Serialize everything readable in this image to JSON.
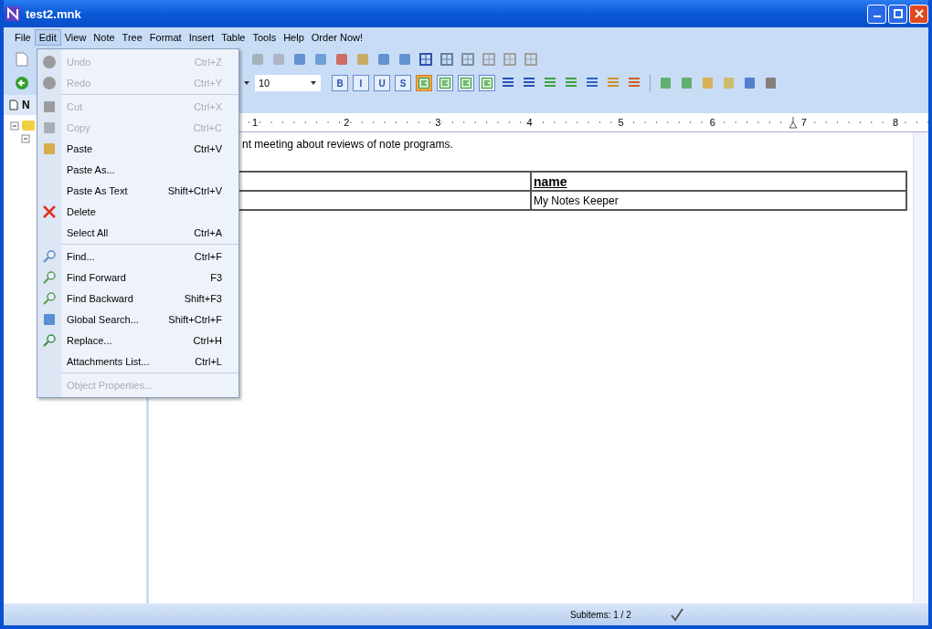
{
  "window": {
    "title": "test2.mnk"
  },
  "menubar": [
    {
      "label": "File",
      "selected": false
    },
    {
      "label": "Edit",
      "selected": true
    },
    {
      "label": "View",
      "selected": false
    },
    {
      "label": "Note",
      "selected": false
    },
    {
      "label": "Tree",
      "selected": false
    },
    {
      "label": "Format",
      "selected": false
    },
    {
      "label": "Insert",
      "selected": false
    },
    {
      "label": "Table",
      "selected": false
    },
    {
      "label": "Tools",
      "selected": false
    },
    {
      "label": "Help",
      "selected": false
    },
    {
      "label": "Order Now!",
      "selected": false
    }
  ],
  "edit_menu": [
    {
      "kind": "item",
      "label": "Undo",
      "shortcut": "Ctrl+Z",
      "disabled": true
    },
    {
      "kind": "item",
      "label": "Redo",
      "shortcut": "Ctrl+Y",
      "disabled": true
    },
    {
      "kind": "separator"
    },
    {
      "kind": "item",
      "label": "Cut",
      "shortcut": "Ctrl+X",
      "disabled": true
    },
    {
      "kind": "item",
      "label": "Copy",
      "shortcut": "Ctrl+C",
      "disabled": true
    },
    {
      "kind": "item",
      "label": "Paste",
      "shortcut": "Ctrl+V",
      "disabled": false
    },
    {
      "kind": "item",
      "label": "Paste As...",
      "disabled": false
    },
    {
      "kind": "item",
      "label": "Paste As Text",
      "shortcut": "Shift+Ctrl+V",
      "disabled": false
    },
    {
      "kind": "item",
      "label": "Delete",
      "disabled": false
    },
    {
      "kind": "item",
      "label": "Select All",
      "shortcut": "Ctrl+A",
      "disabled": false
    },
    {
      "kind": "separator"
    },
    {
      "kind": "item",
      "label": "Find...",
      "shortcut": "Ctrl+F",
      "disabled": false
    },
    {
      "kind": "item",
      "label": "Find Forward",
      "shortcut": "F3",
      "disabled": false
    },
    {
      "kind": "item",
      "label": "Find Backward",
      "shortcut": "Shift+F3",
      "disabled": false
    },
    {
      "kind": "item",
      "label": "Global Search...",
      "shortcut": "Shift+Ctrl+F",
      "disabled": false
    },
    {
      "kind": "item",
      "label": "Replace...",
      "shortcut": "Ctrl+H",
      "disabled": false
    },
    {
      "kind": "item",
      "label": "Attachments List...",
      "shortcut": "Ctrl+L",
      "disabled": false
    },
    {
      "kind": "separator"
    },
    {
      "kind": "item",
      "label": "Object Properties...",
      "disabled": true
    }
  ],
  "format_toolbar": {
    "font_size": "10",
    "buttons": [
      {
        "kind": "text",
        "label": "B",
        "selected": false
      },
      {
        "kind": "text",
        "label": "I",
        "selected": false
      },
      {
        "kind": "text",
        "label": "U",
        "selected": false
      },
      {
        "kind": "text",
        "label": "S",
        "selected": false
      },
      {
        "kind": "align",
        "selected": true
      },
      {
        "kind": "align",
        "selected": false
      },
      {
        "kind": "align",
        "selected": false
      },
      {
        "kind": "align",
        "selected": false
      }
    ]
  },
  "left_panel": {
    "tab": "N"
  },
  "ruler_marks": [
    "1",
    "2",
    "3",
    "4",
    "5",
    "6",
    "7",
    "8"
  ],
  "editor": {
    "paragraph": "nt meeting about reviews of note programs.",
    "table": {
      "header": {
        "column_2": "name"
      },
      "rows": [
        {
          "column_2": "My Notes Keeper"
        }
      ]
    }
  },
  "status_bar": {
    "subitems": "Subitems: 1 / 2"
  }
}
